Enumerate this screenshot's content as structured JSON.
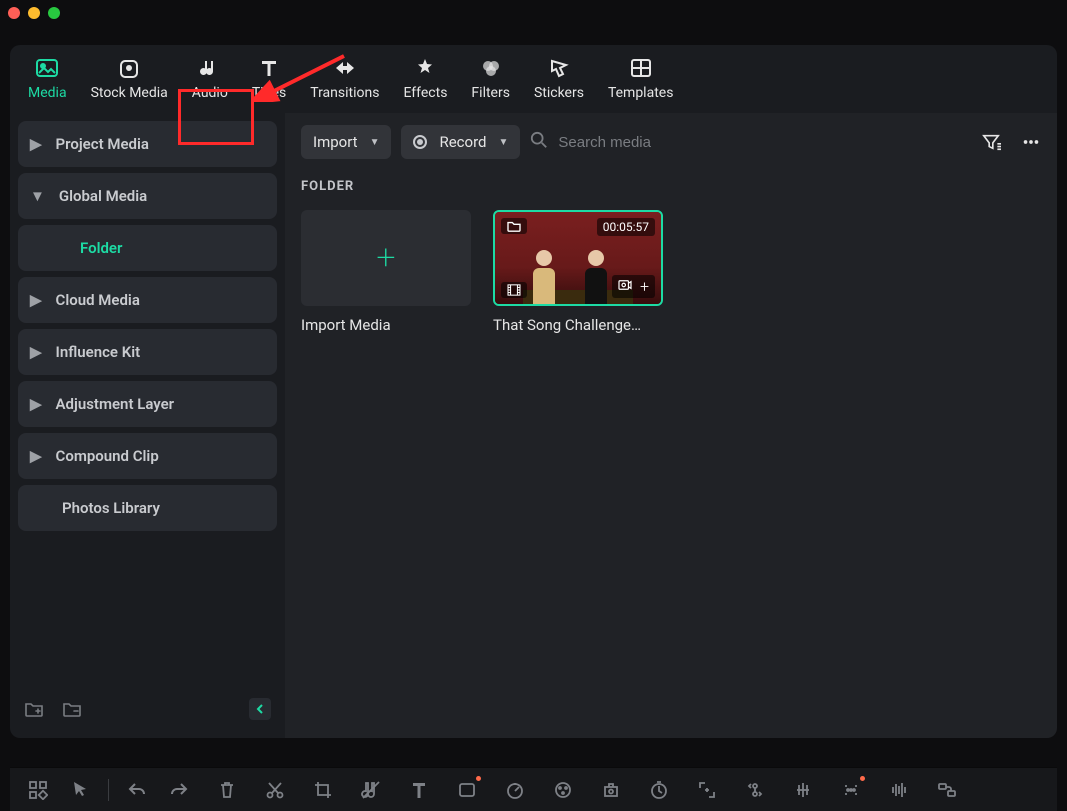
{
  "nav": {
    "tabs": [
      {
        "id": "media",
        "label": "Media"
      },
      {
        "id": "stock",
        "label": "Stock Media"
      },
      {
        "id": "audio",
        "label": "Audio"
      },
      {
        "id": "titles",
        "label": "Titles"
      },
      {
        "id": "transitions",
        "label": "Transitions"
      },
      {
        "id": "effects",
        "label": "Effects"
      },
      {
        "id": "filters",
        "label": "Filters"
      },
      {
        "id": "stickers",
        "label": "Stickers"
      },
      {
        "id": "templates",
        "label": "Templates"
      }
    ],
    "active": "media"
  },
  "sidebar": {
    "items": [
      {
        "label": "Project Media",
        "expandable": true,
        "expanded": false
      },
      {
        "label": "Global Media",
        "expandable": true,
        "expanded": true
      },
      {
        "label": "Folder",
        "indent": true,
        "active": true
      },
      {
        "label": "Cloud Media",
        "expandable": true,
        "expanded": false
      },
      {
        "label": "Influence Kit",
        "expandable": true,
        "expanded": false
      },
      {
        "label": "Adjustment Layer",
        "expandable": true,
        "expanded": false
      },
      {
        "label": "Compound Clip",
        "expandable": true,
        "expanded": false
      },
      {
        "label": "Photos Library",
        "expandable": false
      }
    ]
  },
  "toolbar": {
    "import_label": "Import",
    "record_label": "Record",
    "search_placeholder": "Search media"
  },
  "folder": {
    "section_label": "FOLDER",
    "import_card_label": "Import Media",
    "clip": {
      "title": "That Song Challenge…",
      "duration": "00:05:57"
    }
  }
}
